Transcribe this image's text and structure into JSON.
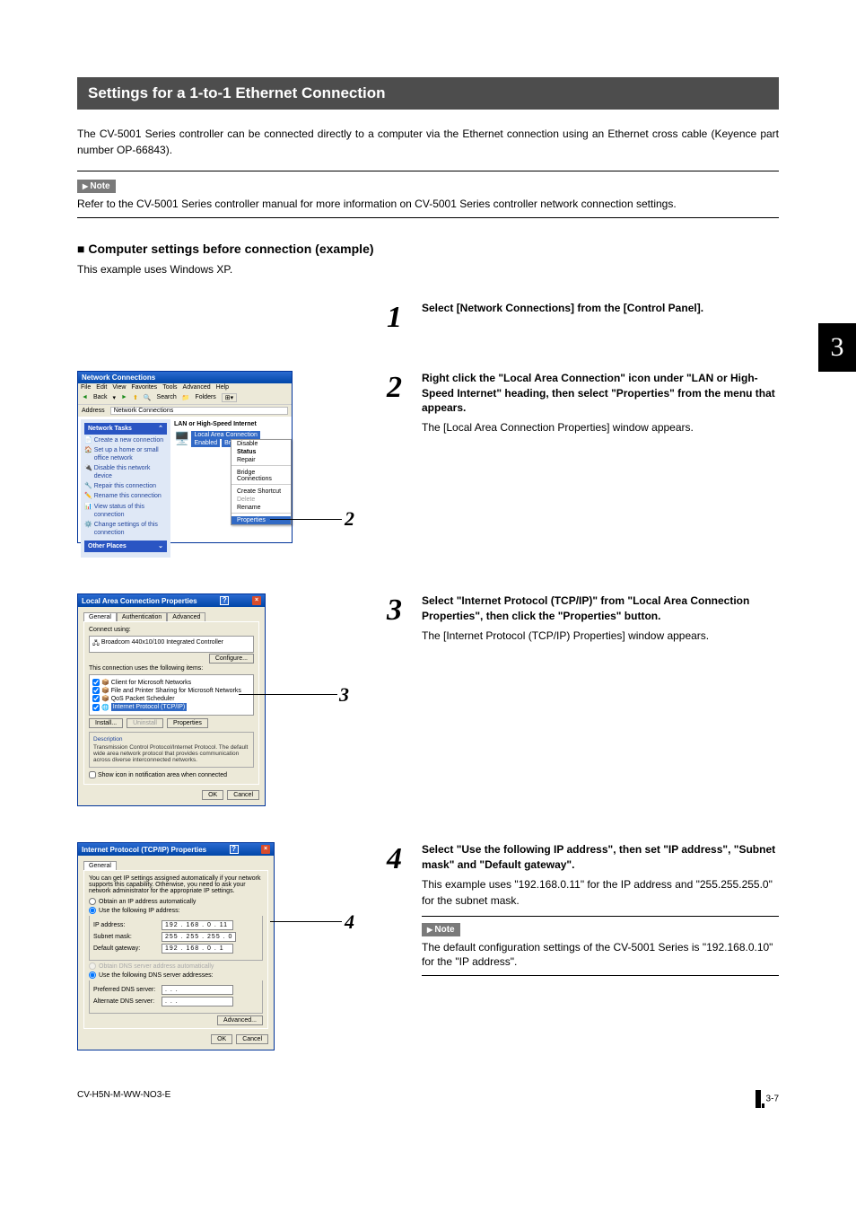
{
  "chapter_tab": "3",
  "title_bar": "Settings for a 1-to-1 Ethernet Connection",
  "intro": "The CV-5001 Series controller can be connected directly to a computer via the Ethernet connection using an Ethernet cross cable (Keyence part number OP-66843).",
  "top_note_label": "Note",
  "top_note_body": "Refer to the CV-5001 Series controller manual for more information on CV-5001 Series controller network connection settings.",
  "subhead": "Computer settings before connection (example)",
  "sub_intro": "This example uses Windows XP.",
  "steps": {
    "s1": {
      "num": "1",
      "title": "Select [Network Connections] from the [Control Panel]."
    },
    "s2": {
      "num": "2",
      "title": "Right click the \"Local Area Connection\" icon under \"LAN or High-Speed Internet\" heading, then select \"Properties\" from the menu that appears.",
      "after": "The [Local Area Connection Properties] window appears.",
      "callout": "2"
    },
    "s3": {
      "num": "3",
      "title": "Select \"Internet Protocol (TCP/IP)\" from \"Local Area Connection Properties\", then click the \"Properties\" button.",
      "after": "The [Internet Protocol (TCP/IP) Properties] window appears.",
      "callout": "3"
    },
    "s4": {
      "num": "4",
      "title": "Select \"Use the following IP address\", then set \"IP address\", \"Subnet mask\" and \"Default gateway\".",
      "after": "This example uses \"192.168.0.11\" for the IP address and \"255.255.255.0\" for the subnet mask.",
      "note_label": "Note",
      "note_body": "The default configuration settings of the CV-5001 Series is \"192.168.0.10\" for the \"IP address\".",
      "callout": "4"
    }
  },
  "shot2": {
    "title": "Network Connections",
    "menus": [
      "File",
      "Edit",
      "View",
      "Favorites",
      "Tools",
      "Advanced",
      "Help"
    ],
    "toolbar_back": "Back",
    "toolbar_search": "Search",
    "toolbar_folders": "Folders",
    "address_label": "Address",
    "address_value": "Network Connections",
    "net_tasks_head": "Network Tasks",
    "net_tasks": [
      "Create a new connection",
      "Set up a home or small office network",
      "Disable this network device",
      "Repair this connection",
      "Rename this connection",
      "View status of this connection",
      "Change settings of this connection"
    ],
    "other_places": "Other Places",
    "section_head": "LAN or High-Speed Internet",
    "lac_sel": "Local Area Connection",
    "lac_sub": "Enabled",
    "lac_adp": "Broadcom 440x ...",
    "ctx": [
      "Disable",
      "Status",
      "Repair",
      "",
      "Bridge Connections",
      "",
      "Create Shortcut",
      "Delete",
      "Rename",
      "",
      "Properties"
    ]
  },
  "shot3": {
    "title": "Local Area Connection Properties",
    "tabs": [
      "General",
      "Authentication",
      "Advanced"
    ],
    "connect_using_label": "Connect using:",
    "adapter": "Broadcom 440x10/100 Integrated Controller",
    "configure": "Configure...",
    "uses_label": "This connection uses the following items:",
    "items": [
      "Client for Microsoft Networks",
      "File and Printer Sharing for Microsoft Networks",
      "QoS Packet Scheduler",
      "Internet Protocol (TCP/IP)"
    ],
    "install": "Install...",
    "uninstall": "Uninstall",
    "properties": "Properties",
    "desc_head": "Description",
    "desc": "Transmission Control Protocol/Internet Protocol. The default wide area network protocol that provides communication across diverse interconnected networks.",
    "show_icon": "Show icon in notification area when connected",
    "ok": "OK",
    "cancel": "Cancel"
  },
  "shot4": {
    "title": "Internet Protocol (TCP/IP) Properties",
    "tab": "General",
    "blurb": "You can get IP settings assigned automatically if your network supports this capability. Otherwise, you need to ask your network administrator for the appropriate IP settings.",
    "r1": "Obtain an IP address automatically",
    "r2": "Use the following IP address:",
    "ip_label": "IP address:",
    "ip_val": "192 . 168 .  0  .  11",
    "mask_label": "Subnet mask:",
    "mask_val": "255 . 255 . 255 .  0",
    "gw_label": "Default gateway:",
    "gw_val": "192 . 168 .  0  .  1",
    "r3": "Obtain DNS server address automatically",
    "r4": "Use the following DNS server addresses:",
    "dns1_label": "Preferred DNS server:",
    "dns2_label": "Alternate DNS server:",
    "dots": ".   .   .",
    "advanced": "Advanced...",
    "ok": "OK",
    "cancel": "Cancel"
  },
  "footer_left": "CV-H5N-M-WW-NO3-E",
  "footer_right": "3-7"
}
